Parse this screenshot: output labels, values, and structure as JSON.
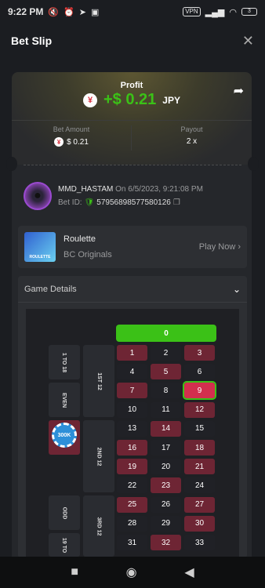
{
  "status": {
    "time": "9:22 PM",
    "icons": [
      "mute-icon",
      "alarm-icon",
      "telegram-icon",
      "lock-icon"
    ],
    "vpn": "VPN",
    "battery": "3"
  },
  "header": {
    "title": "Bet Slip",
    "close": "✕"
  },
  "profit": {
    "label": "Profit",
    "coin_symbol": "¥",
    "value": "+$ 0.21",
    "currency": "JPY"
  },
  "bet_amount": {
    "label": "Bet Amount",
    "value": "$ 0.21"
  },
  "payout": {
    "label": "Payout",
    "value": "2 x"
  },
  "user": {
    "name": "MMD_HASTAM",
    "on_text": "On 6/5/2023, 9:21:08 PM",
    "bet_id_label": "Bet ID:",
    "bet_id": "57956898577580126"
  },
  "game": {
    "name": "Roulette",
    "provider": "BC Originals",
    "thumb_text": "ROULETTE",
    "play_label": "Play Now"
  },
  "details": {
    "label": "Game Details"
  },
  "roulette": {
    "zero": "0",
    "numbers": [
      "1",
      "2",
      "3",
      "4",
      "5",
      "6",
      "7",
      "8",
      "9",
      "10",
      "11",
      "12",
      "13",
      "14",
      "15",
      "16",
      "17",
      "18",
      "19",
      "20",
      "21",
      "22",
      "23",
      "24",
      "25",
      "26",
      "27",
      "28",
      "29",
      "30",
      "31",
      "32",
      "33"
    ],
    "dozens": [
      "1ST 12",
      "2ND 12",
      "3RD 12"
    ],
    "outside": [
      "1 TO 18",
      "EVEN",
      "ODD",
      "19 TO"
    ],
    "chip": "300K",
    "winning_number": "9"
  },
  "colors": {
    "green": "#3bc117",
    "red_cell": "#6e2534",
    "hit_cell": "#d32f4e"
  }
}
